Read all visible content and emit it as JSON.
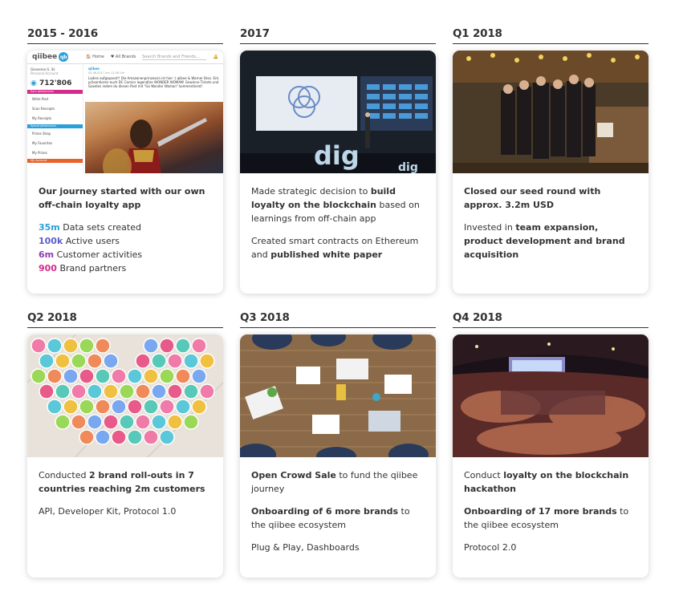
{
  "columns": [
    {
      "heading": "2015 - 2016"
    },
    {
      "heading": "2017"
    },
    {
      "heading": "Q1 2018"
    },
    {
      "heading": "Q2 2018"
    },
    {
      "heading": "Q3 2018"
    },
    {
      "heading": "Q4 2018"
    }
  ],
  "colors": {
    "blue": "#2b9fd8",
    "indigo": "#5a5ec8",
    "purple": "#8a3fae",
    "magenta": "#d42b8c",
    "text": "#333333"
  },
  "card1": {
    "intro": "Our journey started with our own off-chain loyalty app",
    "stats": [
      {
        "num": "35m",
        "label": " Data sets created"
      },
      {
        "num": "100k",
        "label": " Active users"
      },
      {
        "num": "6m",
        "label": " Customer activities"
      },
      {
        "num": "900",
        "label": " Brand partners"
      }
    ],
    "app": {
      "logo": "qiibee",
      "nav_home": "🏠 Home",
      "nav_brands": "♥ All Brands",
      "search_placeholder": "Search Brands and Friends...",
      "user": "Giovanna G. St.",
      "user_sub": "Personal Account",
      "points": "712'806",
      "bar_earn": "Earn qiibeecoins",
      "item_post": "Write Post",
      "item_scan": "Scan Receipts",
      "item_receipts": "My Receipts",
      "bar_spend": "Spend qiibeecoins",
      "item_shop": "Prizes Shop",
      "item_fav": "My Favorites",
      "item_prizes": "My Prizes",
      "bar_account": "My Account",
      "post_author": "qiibee",
      "post_date": "05.06.2017 um 12:58 Uhr",
      "post_text": "Ladies aufgepasst!! Die Amazonenprinzessin ist hier :) qiibee & Warner Bros. Ent. präsentieren euch DC Comics legendäre WONDER WOMAN! Gewinne Tickets und Goodies indem du diesen Post mit \"Go Wonder Woman\" kommentierst!"
    }
  },
  "card2": {
    "p1_a": "Made strategic decision to ",
    "p1_b": "build loyalty on the blockchain",
    "p1_c": " based on learnings from off-chain app",
    "p2_a": "Created smart contracts on Ethereum and ",
    "p2_b": "published white paper"
  },
  "card3": {
    "p1": "Closed our seed round with approx. 3.2m USD",
    "p2_a": "Invested in ",
    "p2_b": "team expansion, product development and brand acquisition"
  },
  "card4": {
    "p1_a": "Conducted ",
    "p1_b": "2 brand roll-outs in 7 countries reaching 2m customers",
    "p2": "API, Developer Kit, Protocol 1.0"
  },
  "card5": {
    "p1_a": "Open Crowd Sale",
    "p1_b": " to fund the qiibee journey",
    "p2_a": "Onboarding of 6 more brands",
    "p2_b": " to the qiibee ecosystem",
    "p3": "Plug & Play, Dashboards"
  },
  "card6": {
    "p1_a": "Conduct ",
    "p1_b": "loyalty on the blockchain hackathon",
    "p2_a": "Onboarding of 17 more brands",
    "p2_b": " to the qiibee ecosystem",
    "p3": "Protocol 2.0"
  }
}
